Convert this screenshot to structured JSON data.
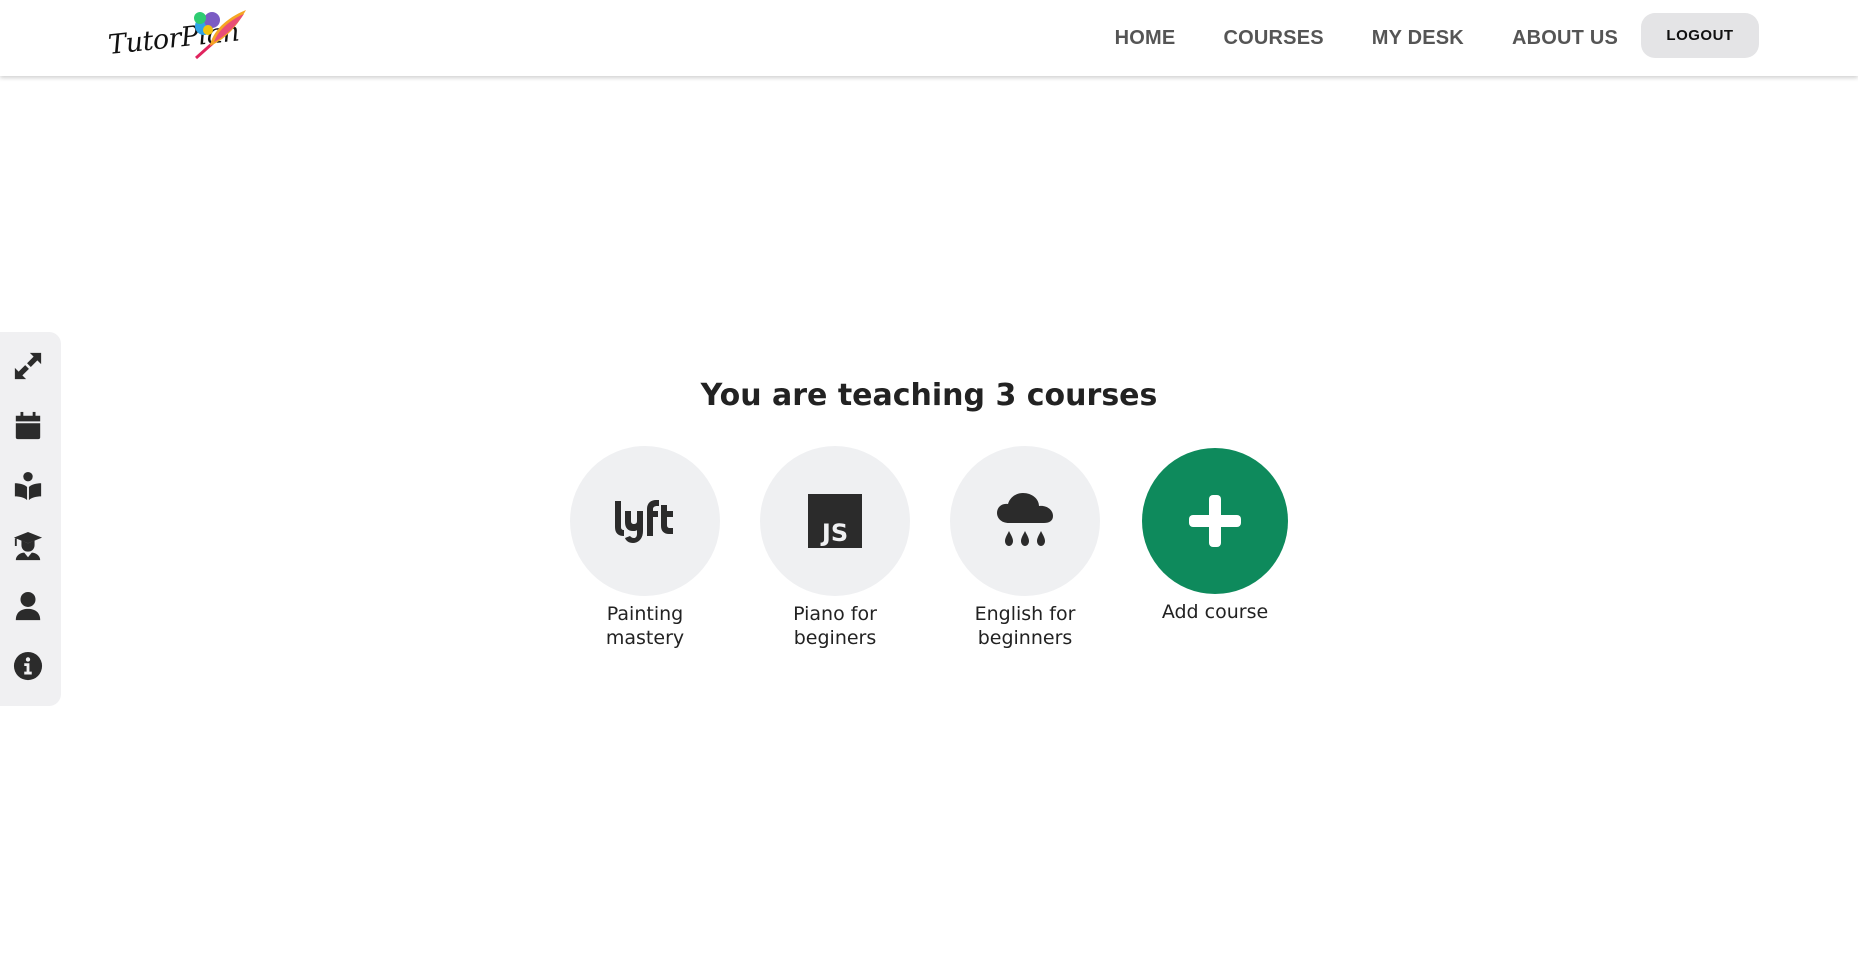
{
  "header": {
    "logo_text": "TutorPlan",
    "nav": [
      "HOME",
      "COURSES",
      "MY DESK",
      "ABOUT US"
    ],
    "logout_label": "LOGOUT"
  },
  "sidebar": {
    "items": [
      {
        "icon": "expand-arrows-icon"
      },
      {
        "icon": "calendar-icon"
      },
      {
        "icon": "book-reader-icon"
      },
      {
        "icon": "graduate-icon"
      },
      {
        "icon": "user-icon"
      },
      {
        "icon": "info-icon"
      }
    ]
  },
  "main": {
    "title": "You are teaching 3 courses",
    "courses": [
      {
        "icon": "lyft-icon",
        "label": "Painting mastery"
      },
      {
        "icon": "js-icon",
        "label": "Piano for beginers"
      },
      {
        "icon": "cloud-rain-icon",
        "label": "English for beginners"
      }
    ],
    "add_label": "Add course",
    "accent_color": "#0e8a5c"
  }
}
